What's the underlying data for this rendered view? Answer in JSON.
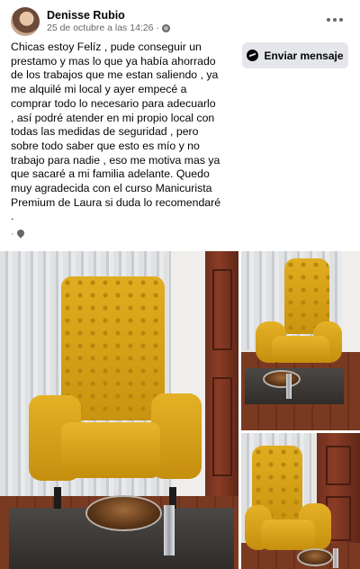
{
  "post": {
    "author": "Denisse Rubio",
    "timestamp": "25 de octubre a las 14:26 · ",
    "audience_icon": "globe-icon",
    "text": "Chicas estoy Felíz , pude conseguir un\nprestamo y mas lo que ya había ahorrado\nde los trabajos que me estan saliendo , ya\nme alquilé mi local y ayer empecé a\ncomprar todo lo necesario para adecuarlo\n, así podré atender en mi propio local con\ntodas las medidas de seguridad , pero\nsobre todo saber que esto es mío y no\ntrabajo para nadie , eso me motiva mas ya\nque sacaré a mi familia adelante. Quedo\nmuy agradecida con el curso Manicurista\nPremium de Laura si duda lo recomendaré\n.",
    "location_prefix": "·"
  },
  "actions": {
    "send_message_label": "Enviar mensaje",
    "more_icon": "more-options-icon"
  },
  "colors": {
    "accent_gray": "#e4e6eb",
    "meta_text": "#65676b",
    "chair_yellow": "#dba81e"
  }
}
